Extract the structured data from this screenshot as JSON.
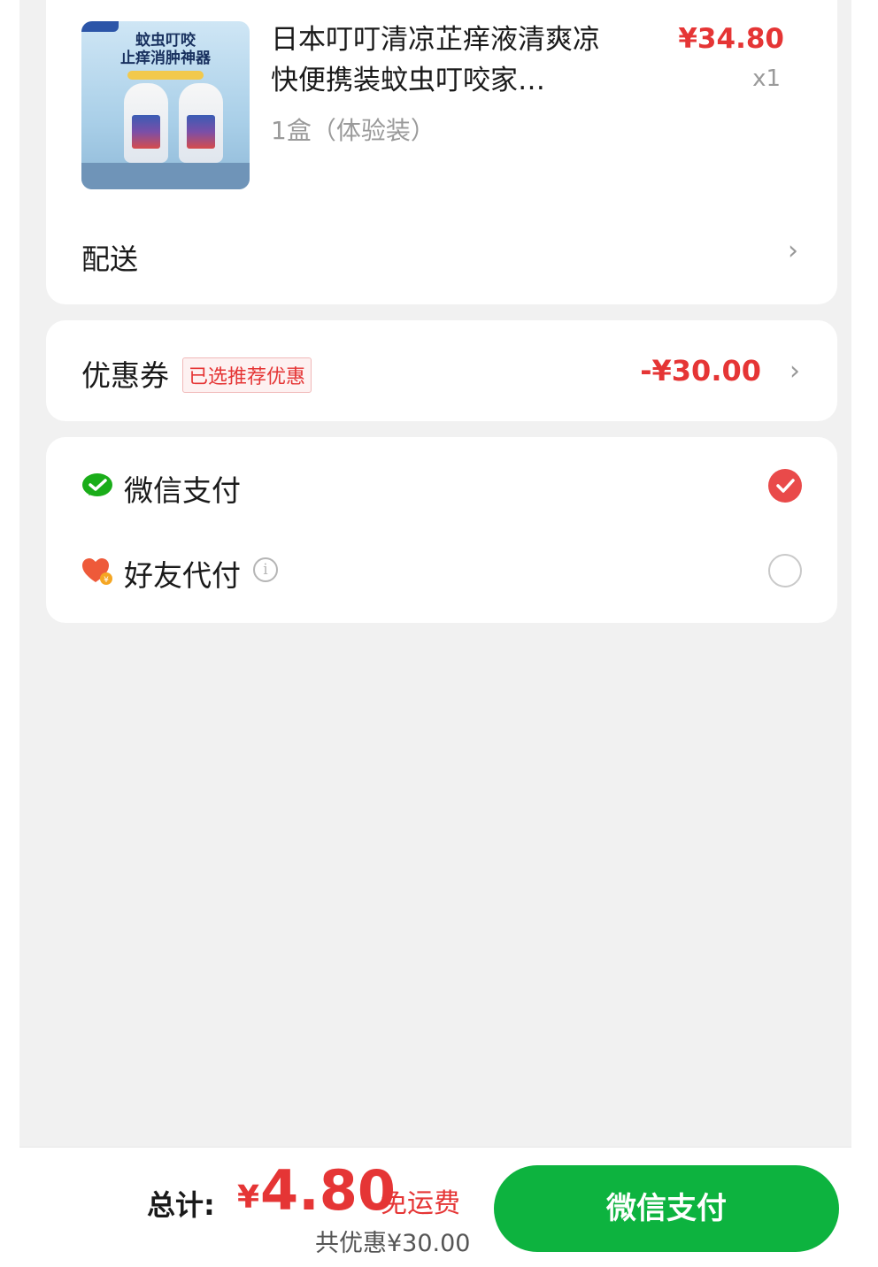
{
  "product": {
    "title": "日本叮叮清凉芷痒液清爽凉快便携装蚊虫叮咬家…",
    "spec": "1盒（体验装）",
    "price": "¥34.80",
    "quantity": "x1",
    "image_text": "蚊虫叮咬\n止痒消肿神器"
  },
  "delivery": {
    "label": "配送"
  },
  "coupon": {
    "label": "优惠券",
    "badge": "已选推荐优惠",
    "amount": "-¥30.00"
  },
  "payment_methods": [
    {
      "label": "微信支付",
      "icon": "wechat-pay-icon",
      "selected": true
    },
    {
      "label": "好友代付",
      "icon": "friend-pay-heart-icon",
      "selected": false
    }
  ],
  "footer": {
    "total_label": "总计:",
    "currency": "¥",
    "total_amount": "4.80",
    "shipping_note": "免运费",
    "saved_text": "共优惠¥30.00",
    "pay_button": "微信支付"
  },
  "colors": {
    "accent_red": "#e53535",
    "wechat_green": "#0db33f",
    "background": "#f1f1f1"
  }
}
